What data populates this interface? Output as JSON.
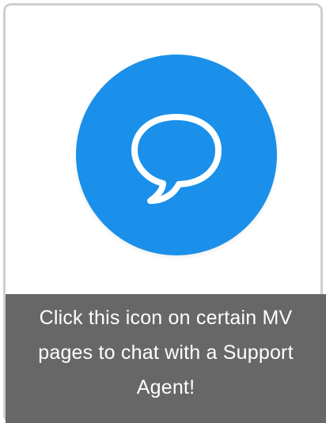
{
  "card": {
    "icon_name": "chat-bubble-icon",
    "icon_bg_color": "#1a90ea",
    "caption_bg_color": "#676767",
    "caption_text": "Click this icon on certain MV pages to chat with a Support Agent!"
  }
}
